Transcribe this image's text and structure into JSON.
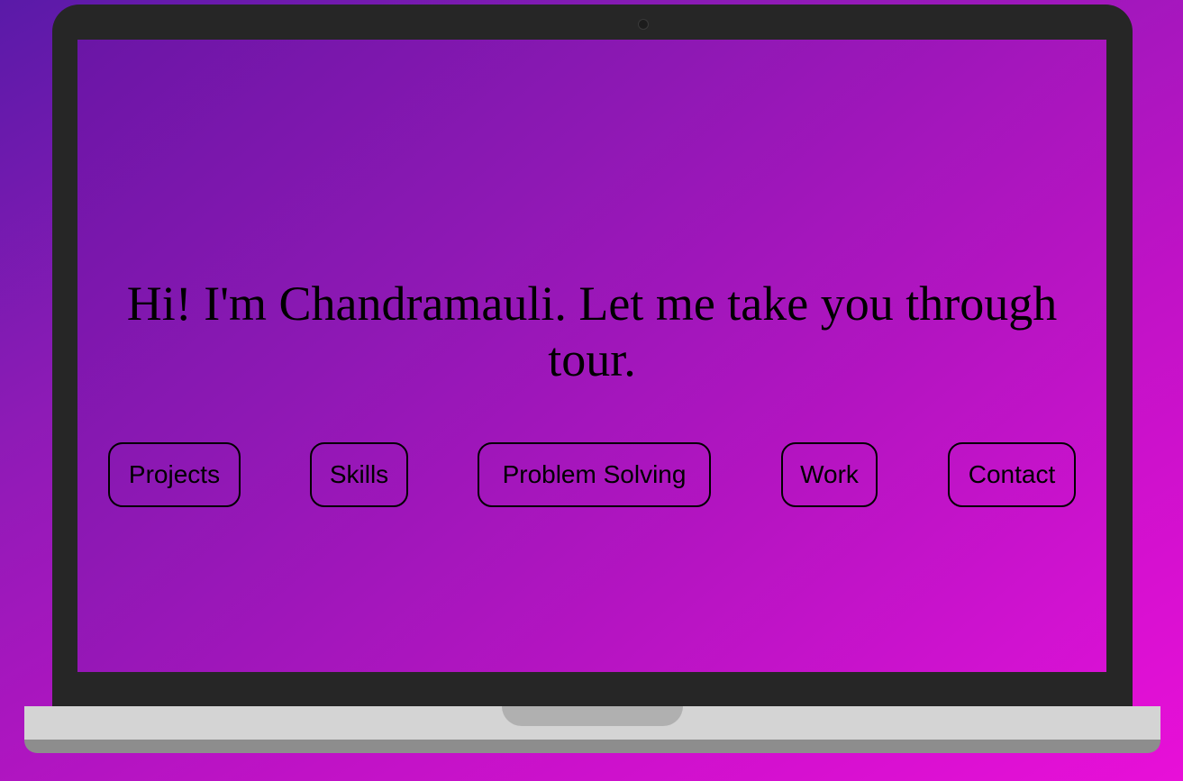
{
  "hero": {
    "headline": "Hi! I'm Chandramauli. Let me take you through tour."
  },
  "nav": {
    "projects_label": "Projects",
    "skills_label": "Skills",
    "problem_solving_label": "Problem Solving",
    "work_label": "Work",
    "contact_label": "Contact"
  },
  "theme": {
    "background_start": "#5a1aa8",
    "background_end": "#e80fd8",
    "laptop_frame": "#262626",
    "laptop_base": "#d4d4d4"
  }
}
